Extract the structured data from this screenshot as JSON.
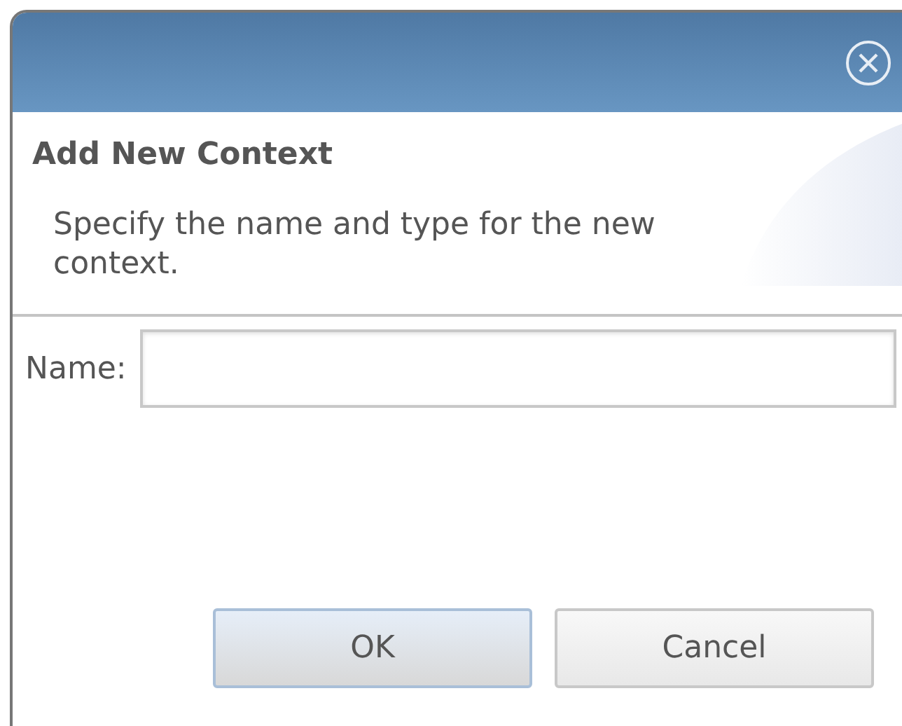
{
  "dialog": {
    "heading": "Add New Context",
    "description": "Specify the name and type for the new context."
  },
  "form": {
    "fields": [
      {
        "label": "Name:"
      }
    ]
  },
  "buttons": [
    {
      "label": "OK",
      "kind": "default"
    },
    {
      "label": "Cancel",
      "kind": "normal"
    }
  ]
}
